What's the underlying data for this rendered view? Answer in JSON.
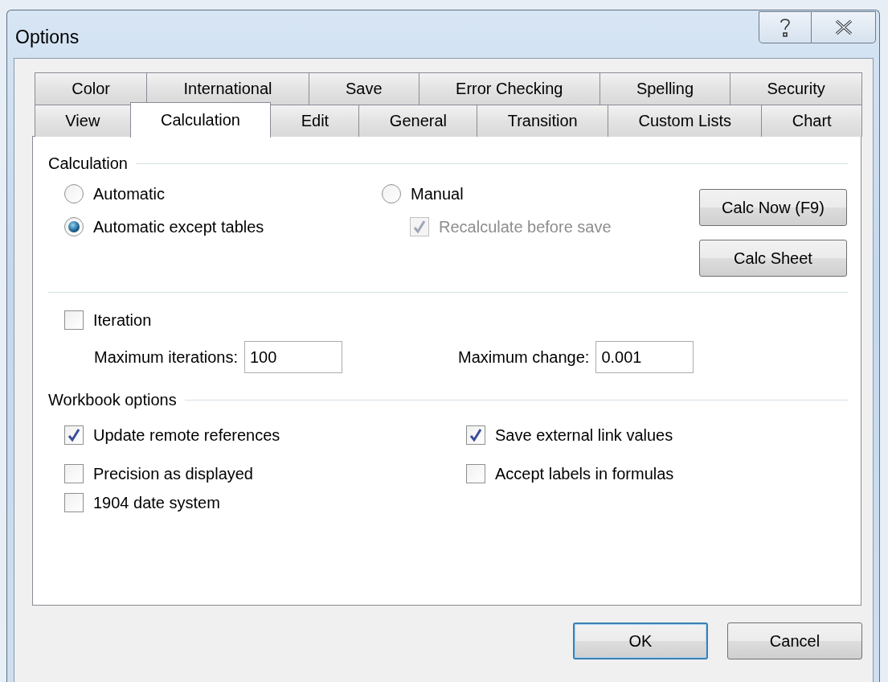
{
  "window": {
    "title": "Options"
  },
  "tabs": [
    [
      {
        "label": "Color",
        "selected": false
      },
      {
        "label": "International",
        "selected": false
      },
      {
        "label": "Save",
        "selected": false
      },
      {
        "label": "Error Checking",
        "selected": false
      },
      {
        "label": "Spelling",
        "selected": false
      },
      {
        "label": "Security",
        "selected": false
      }
    ],
    [
      {
        "label": "View",
        "selected": false
      },
      {
        "label": "Calculation",
        "selected": true
      },
      {
        "label": "Edit",
        "selected": false
      },
      {
        "label": "General",
        "selected": false
      },
      {
        "label": "Transition",
        "selected": false
      },
      {
        "label": "Custom Lists",
        "selected": false
      },
      {
        "label": "Chart",
        "selected": false
      }
    ]
  ],
  "calculation": {
    "heading": "Calculation",
    "modes": [
      {
        "label": "Automatic",
        "selected": false
      },
      {
        "label": "Automatic except tables",
        "selected": true
      },
      {
        "label": "Manual",
        "selected": false
      }
    ],
    "recalculate": {
      "label": "Recalculate before save",
      "checked": true,
      "disabled": true
    },
    "buttons": [
      "Calc Now (F9)",
      "Calc Sheet"
    ]
  },
  "iteration": {
    "label": "Iteration",
    "checked": false,
    "fields": [
      {
        "label": "Maximum iterations:",
        "value": "100"
      },
      {
        "label": "Maximum change:",
        "value": "0.001"
      }
    ]
  },
  "workbook": {
    "heading": "Workbook options",
    "options": [
      {
        "label": "Update remote references",
        "checked": true
      },
      {
        "label": "Save external link values",
        "checked": true
      },
      {
        "label": "Precision as displayed",
        "checked": false
      },
      {
        "label": "Accept labels in formulas",
        "checked": false
      },
      {
        "label": "1904 date system",
        "checked": false
      }
    ]
  },
  "dialog_buttons": [
    {
      "label": "OK",
      "default": true
    },
    {
      "label": "Cancel",
      "default": false
    }
  ]
}
